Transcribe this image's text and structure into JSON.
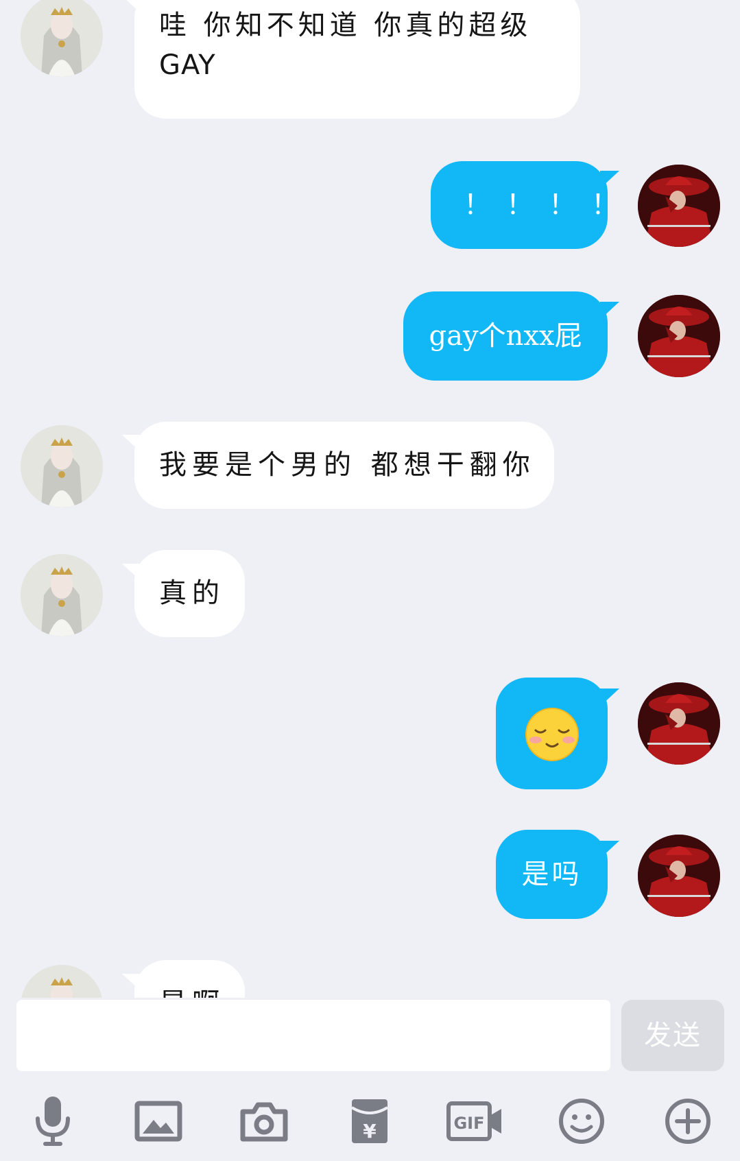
{
  "messages": [
    {
      "side": "left",
      "lines": [
        "哇  你知不知道 你真的超级",
        "GAY"
      ]
    },
    {
      "side": "right",
      "lines": [
        "！！！！"
      ]
    },
    {
      "side": "right",
      "lines": [
        "gay个nxx屁"
      ]
    },
    {
      "side": "left",
      "lines": [
        "我要是个男的 都想干翻你"
      ]
    },
    {
      "side": "left",
      "lines": [
        "真的"
      ]
    },
    {
      "side": "right",
      "emoji": "shy-smile-emoji"
    },
    {
      "side": "right",
      "lines": [
        "是吗"
      ]
    },
    {
      "side": "left",
      "lines": [
        "是啊"
      ]
    }
  ],
  "input": {
    "placeholder": "",
    "value": ""
  },
  "send_label": "发送",
  "toolbar": [
    {
      "icon": "microphone-icon"
    },
    {
      "icon": "image-icon"
    },
    {
      "icon": "camera-icon"
    },
    {
      "icon": "red-packet-icon"
    },
    {
      "icon": "gif-icon"
    },
    {
      "icon": "emoji-icon"
    },
    {
      "icon": "plus-icon"
    }
  ],
  "colors": {
    "background": "#eff0f6",
    "outgoing_bubble": "#12b7f5",
    "incoming_bubble": "#ffffff",
    "icon": "#7b7d86",
    "send_disabled": "#dcdde2"
  }
}
